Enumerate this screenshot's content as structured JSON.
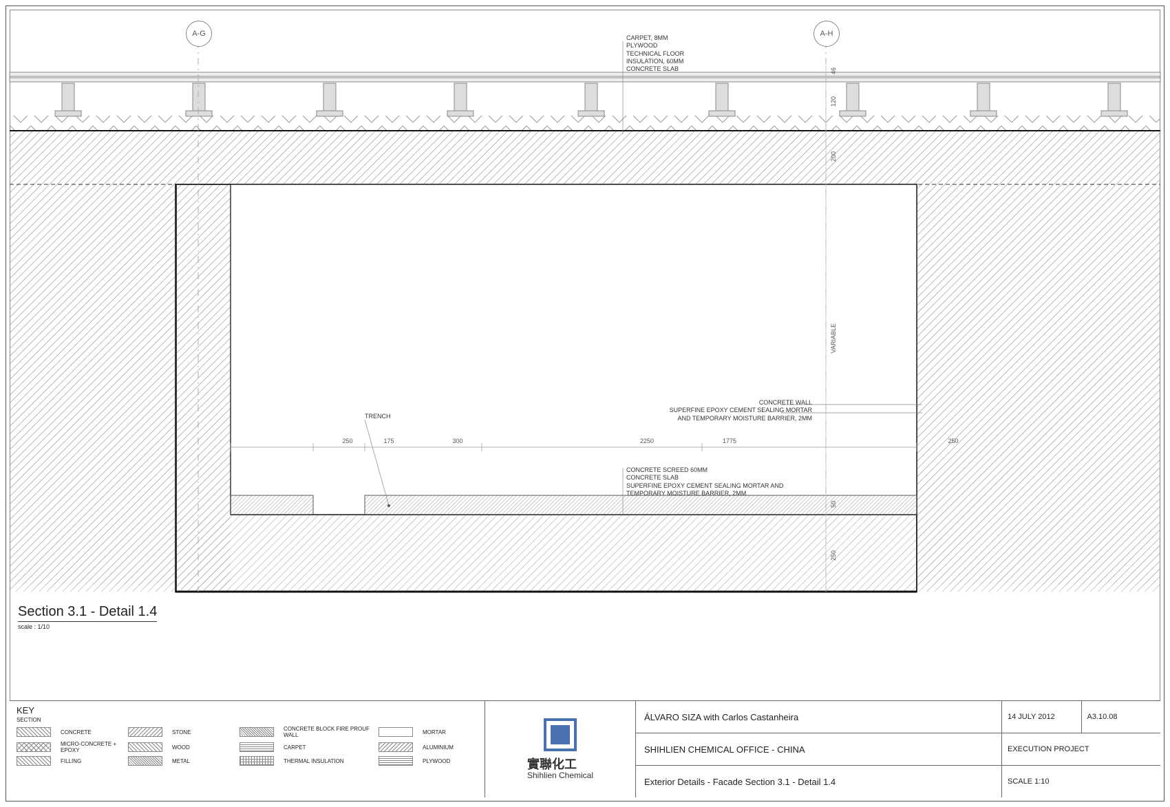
{
  "section": {
    "title": "Section 3.1 - Detail 1.4",
    "scale": "scale : 1/10"
  },
  "grid": {
    "left": "A-G",
    "right": "A-H"
  },
  "notes_floor": [
    "CARPET, 8MM",
    "PLYWOOD",
    "TECHNICAL FLOOR",
    "INSULATION, 60MM",
    "CONCRETE SLAB"
  ],
  "notes_wall": {
    "l1": "CONCRETE WALL",
    "l2": "SUPERFINE EPOXY CEMENT SEALING MORTAR",
    "l3": "AND TEMPORARY MOISTURE BARRIER, 2MM"
  },
  "notes_screed": {
    "l1": "CONCRETE SCREED 60MM",
    "l2": "CONCRETE SLAB",
    "l3": "SUPERFINE EPOXY CEMENT SEALING MORTAR AND",
    "l4": "TEMPORARY MOISTURE BARRIER, 2MM"
  },
  "trench": "TRENCH",
  "dims": {
    "d250l": "250",
    "d175": "175",
    "d300": "300",
    "d2250": "2250",
    "d1775": "1775",
    "d250r": "250",
    "v46": "46",
    "v120": "120",
    "v200": "200",
    "var": "VARIABLE",
    "v50": "50",
    "v250b": "250"
  },
  "key": {
    "title": "KEY",
    "sub": "SECTION",
    "items": [
      "CONCRETE",
      "STONE",
      "CONCRETE BLOCK FIRE PROUF WALL",
      "MORTAR",
      "MICRO-CONCRETE + EPOXY",
      "WOOD",
      "CARPET",
      "ALUMINIUM",
      "FILLING",
      "METAL",
      "THERMAL INSULATION",
      "PLYWOOD"
    ]
  },
  "logo": {
    "cn": "實聯化工",
    "en": "Shihlien Chemical"
  },
  "info": {
    "arch": "ÁLVARO SIZA with Carlos Castanheira",
    "proj": "SHIHLIEN CHEMICAL OFFICE - CHINA",
    "dwg": "Exterior Details - Facade Section 3.1 - Detail 1.4"
  },
  "meta": {
    "date": "14 JULY 2012",
    "num": "A3.10.08",
    "phase": "EXECUTION PROJECT",
    "scale": "SCALE 1:10"
  }
}
